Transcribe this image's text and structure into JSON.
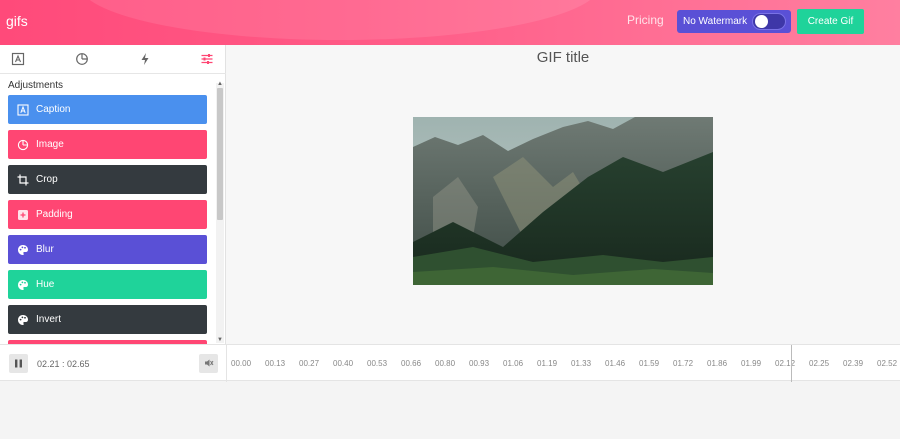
{
  "header": {
    "logo": "gifs",
    "pricing": "Pricing",
    "no_watermark": "No Watermark",
    "create_gif": "Create Gif",
    "brand_color": "#ff4a7a",
    "toggle_on": true
  },
  "sidebar": {
    "tabs": [
      {
        "name": "caption-tab",
        "icon": "text-frame-icon"
      },
      {
        "name": "image-tab",
        "icon": "pie-icon"
      },
      {
        "name": "effects-tab",
        "icon": "bolt-icon"
      },
      {
        "name": "adjustments-tab",
        "icon": "sliders-icon",
        "active": true
      }
    ],
    "section_title": "Adjustments",
    "items": [
      {
        "label": "Caption",
        "color": "#4a90ee",
        "icon": "text-frame-icon"
      },
      {
        "label": "Image",
        "color": "#ff4673",
        "icon": "pie-icon"
      },
      {
        "label": "Crop",
        "color": "#343a3f",
        "icon": "crop-icon"
      },
      {
        "label": "Padding",
        "color": "#ff4673",
        "icon": "padding-icon"
      },
      {
        "label": "Blur",
        "color": "#5a50d6",
        "icon": "palette-icon"
      },
      {
        "label": "Hue",
        "color": "#1fd39a",
        "icon": "palette-icon"
      },
      {
        "label": "Invert",
        "color": "#343a3f",
        "icon": "palette-icon"
      },
      {
        "label": "",
        "color": "#ff4673",
        "icon": ""
      }
    ]
  },
  "canvas": {
    "title": "GIF title"
  },
  "timeline": {
    "current": "02.21",
    "separator": ":",
    "total": "02.65",
    "time_display": "02.21 : 02.65",
    "ticks": [
      "00.00",
      "00.13",
      "00.27",
      "00.40",
      "00.53",
      "00.66",
      "00.80",
      "00.93",
      "01.06",
      "01.19",
      "01.33",
      "01.46",
      "01.59",
      "01.72",
      "01.86",
      "01.99",
      "02.12",
      "02.25",
      "02.39",
      "02.52"
    ]
  }
}
